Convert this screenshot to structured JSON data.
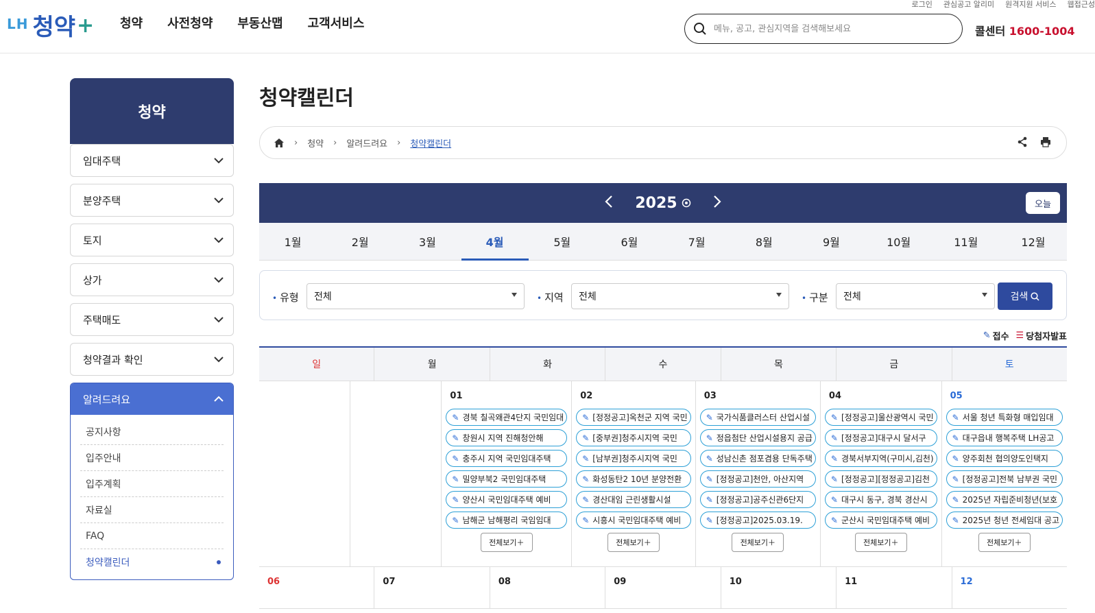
{
  "header": {
    "logo_lh": "LH",
    "logo_main": "청약",
    "logo_plus": "+",
    "gnb": [
      "청약",
      "사전청약",
      "부동산맵",
      "고객서비스"
    ],
    "util_links": [
      "로그인",
      "관심공고 알리미",
      "원격지원 서비스",
      "웹접근성"
    ],
    "search_placeholder": "메뉴, 공고, 관심지역을 검색해보세요",
    "callcenter_label": "콜센터",
    "callcenter_number": "1600-1004"
  },
  "sidebar": {
    "title": "청약",
    "items": [
      "임대주택",
      "분양주택",
      "토지",
      "상가",
      "주택매도",
      "청약결과 확인"
    ],
    "open_item": "알려드려요",
    "sub_items": [
      "공지사항",
      "입주안내",
      "입주계획",
      "자료실",
      "FAQ",
      "청약캘린더"
    ],
    "active_sub": "청약캘린더"
  },
  "main": {
    "title": "청약캘린더",
    "breadcrumb": [
      "청약",
      "알려드려요",
      "청약캘린더"
    ]
  },
  "calendar": {
    "year": "2025",
    "today_label": "오늘",
    "months": [
      "1월",
      "2월",
      "3월",
      "4월",
      "5월",
      "6월",
      "7월",
      "8월",
      "9월",
      "10월",
      "11월",
      "12월"
    ],
    "active_month": "4월",
    "filters": {
      "type_label": "유형",
      "type_value": "전체",
      "region_label": "지역",
      "region_value": "전체",
      "category_label": "구분",
      "category_value": "전체",
      "search_label": "검색"
    },
    "legend": {
      "receipt": "접수",
      "winner": "당첨자발표"
    },
    "weekdays": [
      "일",
      "월",
      "화",
      "수",
      "목",
      "금",
      "토"
    ],
    "more_label": "전체보기",
    "week1": [
      {
        "day": "",
        "events": []
      },
      {
        "day": "",
        "events": []
      },
      {
        "day": "01",
        "events": [
          "경북 칠곡왜관4단지 국민임대",
          "창원시 지역 진해청안해",
          "충주시 지역 국민임대주택",
          "밀양부북2 국민임대주택",
          "양산시 국민임대주택 예비",
          "남해군 남해평리 국임임대"
        ]
      },
      {
        "day": "02",
        "events": [
          "[정정공고]옥천군 지역 국민",
          "[중부권]청주시지역 국민",
          "[남부권]청주시지역 국민",
          "화성동탄2 10년 분양전환",
          "경산대임 근린생활시설",
          "시흥시 국민임대주택 예비"
        ]
      },
      {
        "day": "03",
        "events": [
          "국가식품클러스터 산업시설",
          "정읍첨단 산업시설용지 공급",
          "성남신촌 점포겸용 단독주택",
          "[정정공고]천안, 아산지역",
          "[정정공고]공주신관6단지",
          "[정정공고]2025.03.19."
        ]
      },
      {
        "day": "04",
        "events": [
          "[정정공고]울산광역시 국민",
          "[정정공고]대구시 달서구",
          "경북서부지역(구미시,김천)",
          "[정정공고][정정공고]김천",
          "대구시 동구, 경북 경산시",
          "군산시 국민임대주택 예비"
        ]
      },
      {
        "day": "05",
        "events": [
          "서울 청년 특화형 매입임대",
          "대구읍내 행복주택 LH공고",
          "양주회천 협의양도인택지",
          "[정정공고]전북 남부권 국민",
          "2025년 자립준비청년(보호",
          "2025년 청년 전세임대 공고"
        ]
      }
    ],
    "week2": [
      "06",
      "07",
      "08",
      "09",
      "10",
      "11",
      "12"
    ]
  }
}
